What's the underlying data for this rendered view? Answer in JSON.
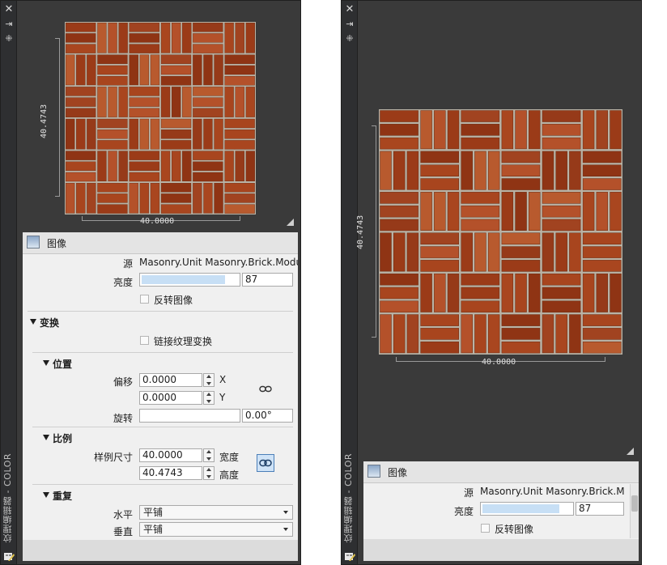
{
  "palette_title": "纹理编辑器 - COLOR",
  "titlebar": {
    "close_icon": "close-icon",
    "pin_icon": "auto-hide-icon",
    "props_icon": "properties-icon"
  },
  "preview": {
    "width_dim": "40.0000",
    "height_dim": "40.4743",
    "texture": "Masonry.Unit Masonry.Brick.Modular.Herringbone"
  },
  "image_section": {
    "title": "图像",
    "source_label": "源",
    "source_value": "Masonry.Unit Masonry.Brick.Modular",
    "source_value_short": "Masonry.Unit Masonry.Brick.M",
    "brightness_label": "亮度",
    "brightness_value": "87",
    "brightness_fraction": 0.87,
    "invert_label": "反转图像",
    "invert_checked": false
  },
  "transform": {
    "title": "变换",
    "link_label": "链接纹理变换",
    "link_checked": false,
    "position": {
      "title": "位置",
      "offset_label": "偏移",
      "offset_x": "0.0000",
      "offset_y": "0.0000",
      "x_label": "X",
      "y_label": "Y",
      "rotation_label": "旋转",
      "rotation_value": "0.00°"
    },
    "scale": {
      "title": "比例",
      "sample_size_label": "样例尺寸",
      "width_value": "40.0000",
      "width_label": "宽度",
      "height_value": "40.4743",
      "height_label": "高度"
    },
    "repeat": {
      "title": "重复",
      "horizontal_label": "水平",
      "horizontal_value": "平铺",
      "vertical_label": "垂直",
      "vertical_value": "平铺"
    }
  },
  "colors": {
    "panel_bg": "#3a3a3a",
    "brick": "#a8451e",
    "mortar": "#b9b3a6",
    "slider_fill": "#c7dff5"
  }
}
